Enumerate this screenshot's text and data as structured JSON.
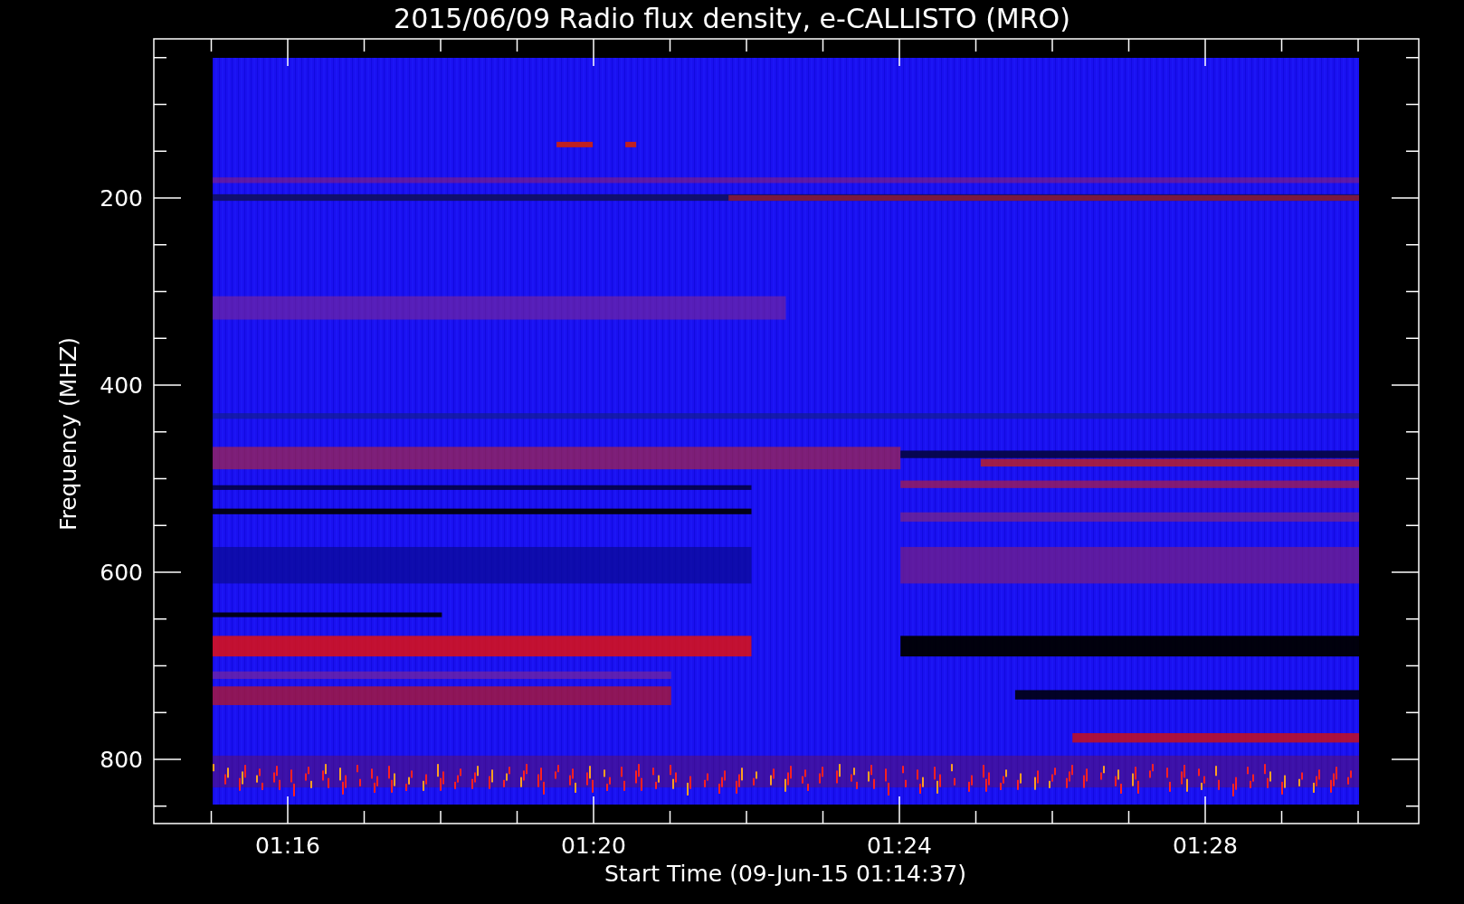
{
  "title": "2015/06/09  Radio flux density, e-CALLISTO (MRO)",
  "ylabel": "Frequency (MHZ)",
  "xlabel": "Start Time (09-Jun-15 01:14:37)",
  "y_tick_labels": [
    "200",
    "400",
    "600",
    "800"
  ],
  "x_tick_labels": [
    "01:16",
    "01:20",
    "01:24",
    "01:28"
  ]
}
